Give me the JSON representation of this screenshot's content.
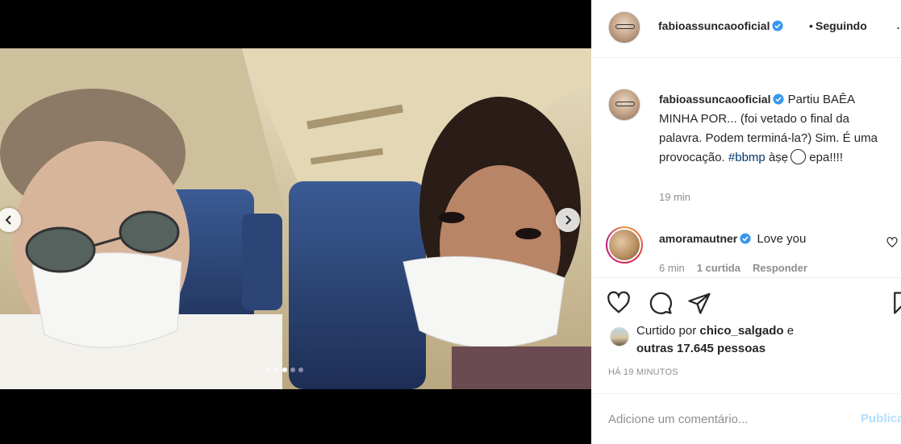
{
  "post": {
    "username": "fabioassuncaooficial",
    "separator": "•",
    "follow_status": "Seguindo",
    "more_label": "...",
    "carousel": {
      "slide_count": 5,
      "active_index": 2
    }
  },
  "caption": {
    "username": "fabioassuncaooficial",
    "text_before_hashtag": "Partiu BAÊA MINHA POR... (foi vetado o final da palavra. Podem terminá-la?) Sim. É uma provocação.",
    "hashtag": "#bbmp",
    "text_after_hashtag": "àṣẹ",
    "tail": "epa!!!!",
    "time": "19 min"
  },
  "comment": {
    "username": "amoramautner",
    "text": "Love you",
    "time": "6 min",
    "likes": "1 curtida",
    "reply_label": "Responder"
  },
  "likes": {
    "prefix": "Curtido por",
    "user": "chico_salgado",
    "conj": "e",
    "others": "outras 17.645 pessoas"
  },
  "posted_ago": "HÁ 19 MINUTOS",
  "add_comment": {
    "placeholder": "Adicione um comentário...",
    "post_label": "Publicar"
  },
  "icons": {
    "verified": "verified-badge-icon",
    "like": "heart-icon",
    "comment": "comment-bubble-icon",
    "share": "paper-plane-icon",
    "save": "bookmark-icon",
    "prev": "chevron-left-icon",
    "next": "chevron-right-icon"
  },
  "colors": {
    "verified": "#3897f0",
    "hashtag": "#00376b",
    "muted": "#8e8e8e",
    "post_disabled": "#b2dffc"
  }
}
